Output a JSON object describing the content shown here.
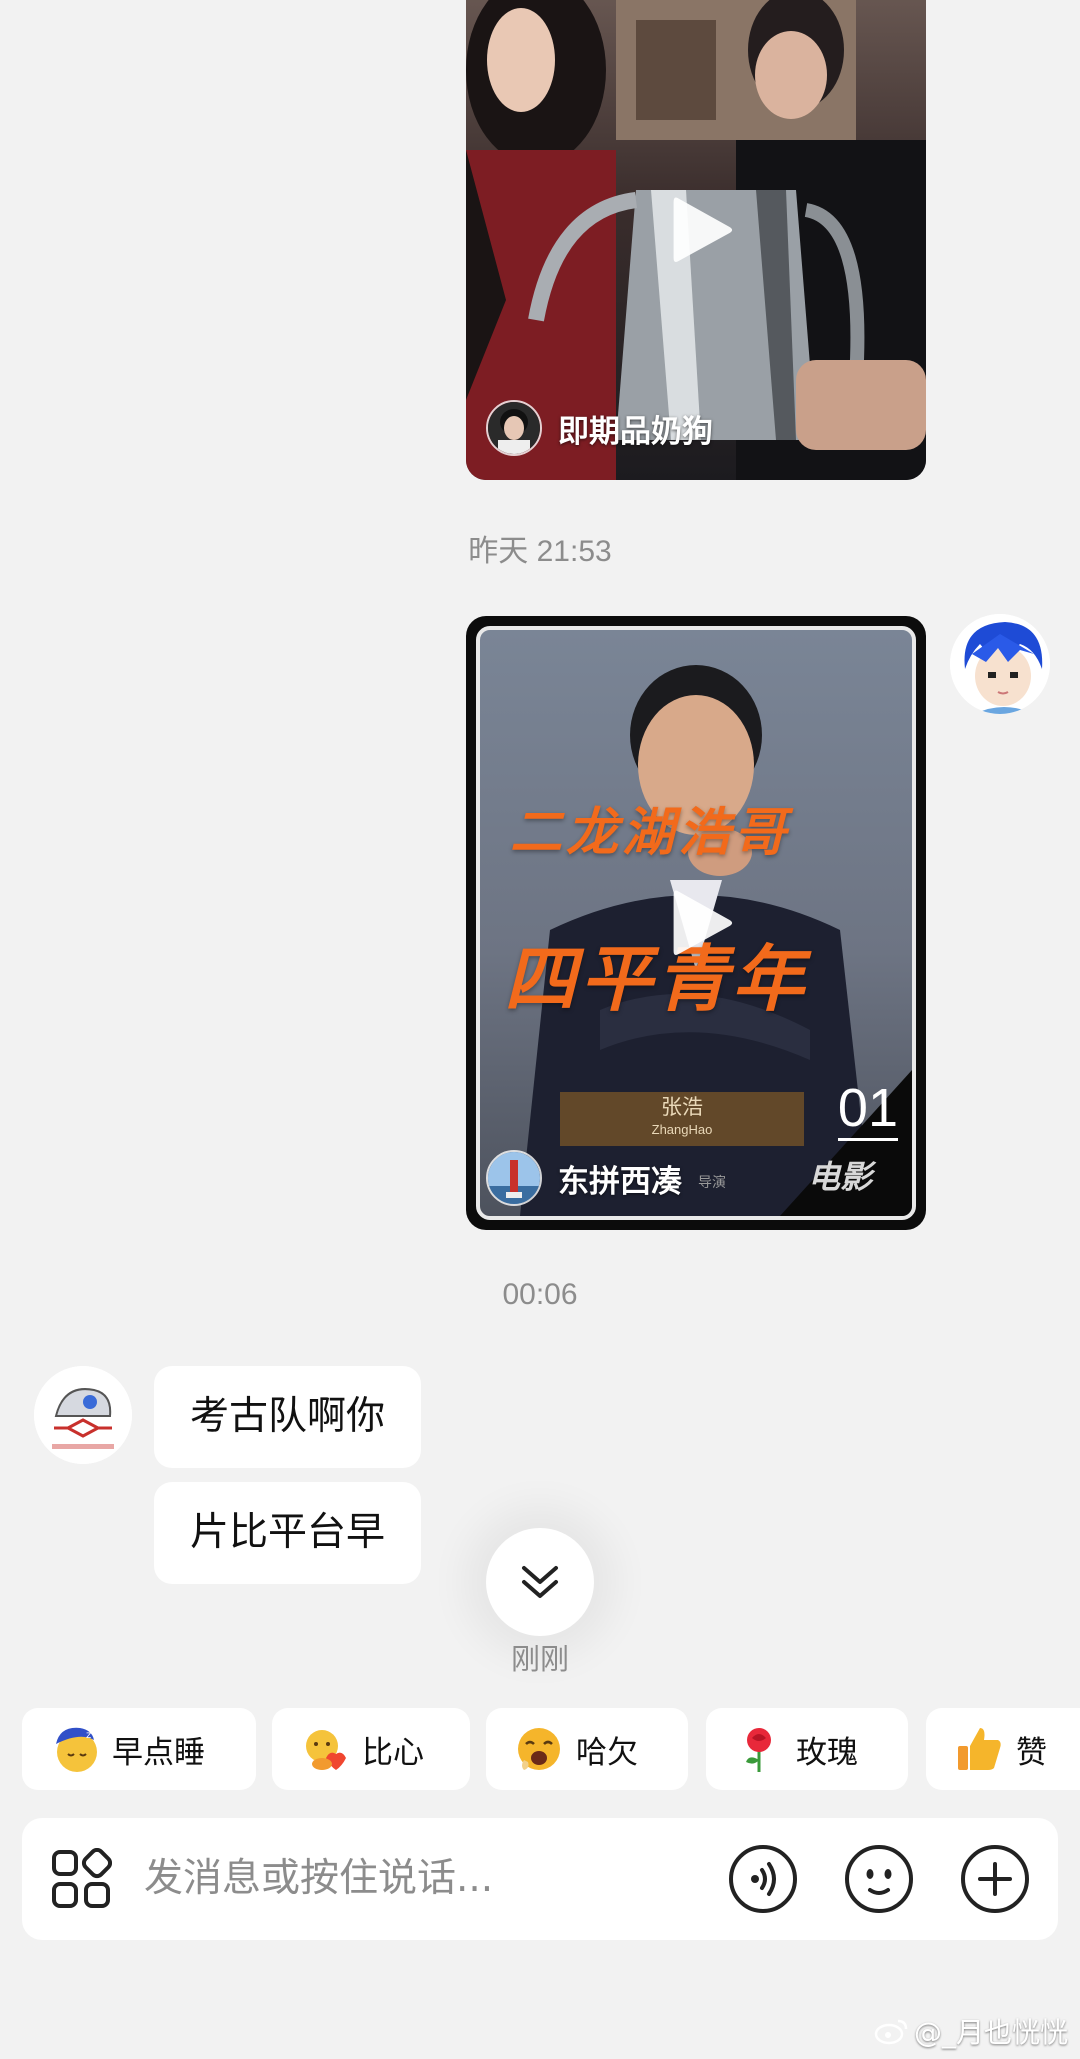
{
  "messages": {
    "video1": {
      "author": "即期品奶狗"
    },
    "time1": "昨天 21:53",
    "video2": {
      "author": "东拼西凑",
      "poster_title_1": "二龙湖浩哥",
      "poster_title_2": "四平青年",
      "poster_name_cn": "张浩",
      "poster_name_en": "ZhangHao",
      "poster_director": "导演",
      "poster_number": "01",
      "poster_brand": "电影"
    },
    "time2": "00:06",
    "text1": "考古队啊你",
    "text2": "片比平台早"
  },
  "scroll_down": {
    "label": "刚刚"
  },
  "quick_replies": [
    {
      "label": "早点睡",
      "icon": "sleep-emoji-icon"
    },
    {
      "label": "比心",
      "icon": "heart-hands-emoji-icon"
    },
    {
      "label": "哈欠",
      "icon": "yawn-emoji-icon"
    },
    {
      "label": "玫瑰",
      "icon": "rose-emoji-icon"
    },
    {
      "label": "赞",
      "icon": "thumbs-up-emoji-icon"
    }
  ],
  "input": {
    "placeholder": "发消息或按住说话..."
  },
  "watermark": "@_月也恍恍",
  "colors": {
    "background": "#f2f2f2",
    "bubble": "#ffffff",
    "poster_orange": "#f26a1b",
    "muted_text": "#8c8c8c"
  }
}
